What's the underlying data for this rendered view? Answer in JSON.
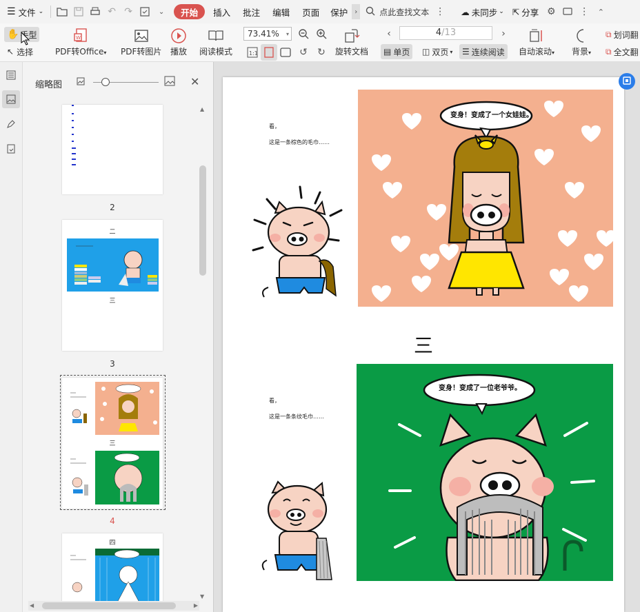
{
  "menubar": {
    "file_label": "文件",
    "tabs": [
      "开始",
      "插入",
      "批注",
      "编辑",
      "页面",
      "保护"
    ],
    "search_placeholder": "点此查找文本",
    "sync_label": "未同步",
    "share_label": "分享"
  },
  "toolbar": {
    "hand_label": "手型",
    "select_label": "选择",
    "pdf_to_office": "PDF转Office",
    "pdf_to_image": "PDF转图片",
    "play": "播放",
    "read_mode": "阅读模式",
    "zoom": "73.41%",
    "rotate": "旋转文档",
    "page_current": "4",
    "page_total": "/13",
    "single_page": "单页",
    "double_page": "双页",
    "continuous": "连续阅读",
    "auto_scroll": "自动滚动",
    "background": "背景",
    "word_select": "划词翻",
    "full_text": "全文翻"
  },
  "thumbnails": {
    "title": "缩略图",
    "page_labels": [
      "2",
      "3",
      "4"
    ],
    "thumb_headings": [
      "二",
      "三",
      "三",
      "四"
    ]
  },
  "document": {
    "section1": {
      "caption_line1": "看，",
      "caption_line2": "这是一条棕色的毛巾……",
      "bubble": "变身！变成了一个女娃娃。"
    },
    "heading": "三",
    "section2": {
      "caption_line1": "看，",
      "caption_line2": "这是一条条纹毛巾……",
      "bubble": "变身！变成了一位老爷爷。"
    }
  },
  "colors": {
    "accent": "#d9534f",
    "peach_bg": "#f4b08f",
    "green_bg": "#0a9b45",
    "blue_bg": "#1fa0e8",
    "pig_pink": "#f7d3c3",
    "yellow": "#ffe600",
    "hair_brown": "#a47d0c",
    "shorts_blue": "#1f8be0"
  }
}
